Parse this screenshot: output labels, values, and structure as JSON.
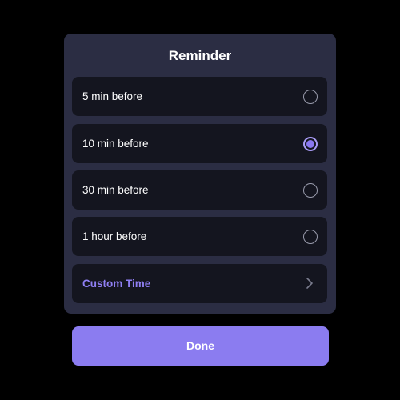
{
  "dialog": {
    "title": "Reminder",
    "options": [
      {
        "label": "5 min before",
        "selected": false
      },
      {
        "label": "10 min before",
        "selected": true
      },
      {
        "label": "30 min before",
        "selected": false
      },
      {
        "label": "1 hour before",
        "selected": false
      }
    ],
    "custom_label": "Custom Time",
    "custom_icon": "chevron-right-icon"
  },
  "done_label": "Done",
  "colors": {
    "background": "#000000",
    "dialog": "#2b2d43",
    "option": "#14151f",
    "accent": "#8b7cf0",
    "text": "#ffffff"
  }
}
